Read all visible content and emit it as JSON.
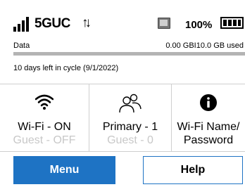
{
  "status": {
    "network": "5GUC",
    "transfer_icon": "up-down-arrows-icon",
    "battery_percent": "100%"
  },
  "usage": {
    "label": "Data",
    "value": "0.00 GBI10.0 GB used",
    "used_fraction": 0.0,
    "cycle_text": "10 days left in cycle (9/1/2022)"
  },
  "tiles": [
    {
      "icon": "wifi-icon",
      "line1": "Wi-Fi - ON",
      "line2": "Guest - OFF"
    },
    {
      "icon": "users-icon",
      "line1": "Primary - 1",
      "line2": "Guest - 0"
    },
    {
      "icon": "info-icon",
      "line1": "Wi-Fi Name/",
      "line2": "Password"
    }
  ],
  "buttons": {
    "menu": "Menu",
    "help": "Help"
  },
  "colors": {
    "accent": "#1e73c4",
    "usage_track": "#b4b4b4",
    "dim_text": "#c8c8c8"
  }
}
